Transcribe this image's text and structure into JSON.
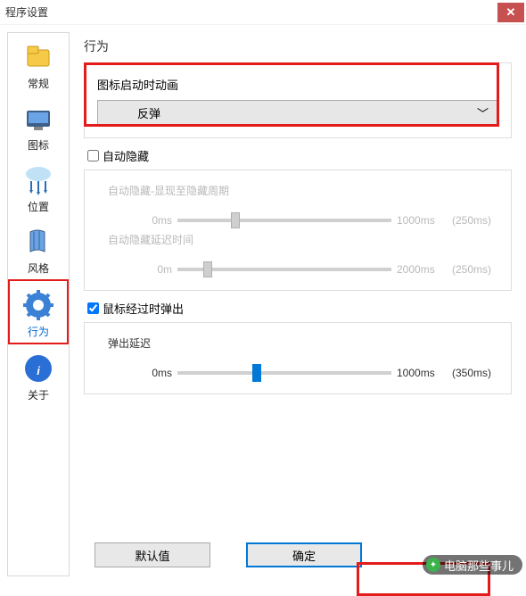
{
  "window": {
    "title": "程序设置"
  },
  "sidebar": {
    "items": [
      {
        "label": "常规",
        "icon": "general-icon"
      },
      {
        "label": "图标",
        "icon": "icon-icon"
      },
      {
        "label": "位置",
        "icon": "position-icon"
      },
      {
        "label": "风格",
        "icon": "style-icon"
      },
      {
        "label": "行为",
        "icon": "behavior-icon",
        "selected": true
      },
      {
        "label": "关于",
        "icon": "about-icon"
      }
    ]
  },
  "content": {
    "heading": "行为",
    "animation_label": "图标启动时动画",
    "animation_value": "反弹",
    "auto_hide_checked": false,
    "auto_hide_label": "自动隐藏",
    "auto_hide_cycle_label": "自动隐藏-显现至隐藏周期",
    "slider1": {
      "min_label": "0ms",
      "max_label": "1000ms",
      "value_label": "(250ms)",
      "pos_pct": 25
    },
    "auto_hide_delay_label": "自动隐藏延迟时间",
    "slider2": {
      "min_label": "0m",
      "max_label": "2000ms",
      "value_label": "(250ms)",
      "pos_pct": 12
    },
    "mouse_popup_checked": true,
    "mouse_popup_label": "鼠标经过时弹出",
    "popup_delay_label": "弹出延迟",
    "slider3": {
      "min_label": "0ms",
      "max_label": "1000ms",
      "value_label": "(350ms)",
      "pos_pct": 35
    }
  },
  "buttons": {
    "default": "默认值",
    "ok": "确定"
  },
  "watermark": {
    "text": "电脑那些事儿"
  }
}
